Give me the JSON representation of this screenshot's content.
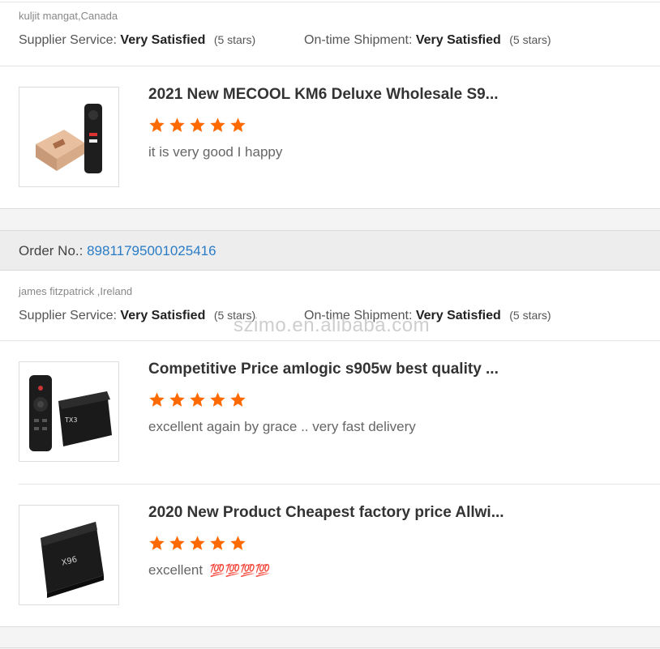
{
  "reviews": [
    {
      "reviewer": "kuljit mangat,Canada",
      "supplier_label": "Supplier Service:",
      "supplier_value": "Very Satisfied",
      "supplier_stars": "(5 stars)",
      "shipment_label": "On-time Shipment:",
      "shipment_value": "Very Satisfied",
      "shipment_stars": "(5 stars)",
      "products": [
        {
          "title": "2021 New MECOOL KM6 Deluxe Wholesale S9...",
          "rating": 5,
          "comment": "it is very good I happy"
        }
      ]
    },
    {
      "order_label": "Order No.:",
      "order_number": "89811795001025416",
      "reviewer": "james fitzpatrick ,Ireland",
      "supplier_label": "Supplier Service:",
      "supplier_value": "Very Satisfied",
      "supplier_stars": "(5 stars)",
      "shipment_label": "On-time Shipment:",
      "shipment_value": "Very Satisfied",
      "shipment_stars": "(5 stars)",
      "products": [
        {
          "title": "Competitive Price amlogic s905w best quality ...",
          "rating": 5,
          "comment": "excellent again by grace .. very fast delivery"
        },
        {
          "title": "2020 New Product Cheapest factory price Allwi...",
          "rating": 5,
          "comment": "excellent",
          "emoji": "💯💯💯💯"
        }
      ]
    }
  ],
  "watermark": "szimo.en.alibaba.com",
  "colors": {
    "star": "#ff6a00",
    "link": "#2a7cc7"
  }
}
